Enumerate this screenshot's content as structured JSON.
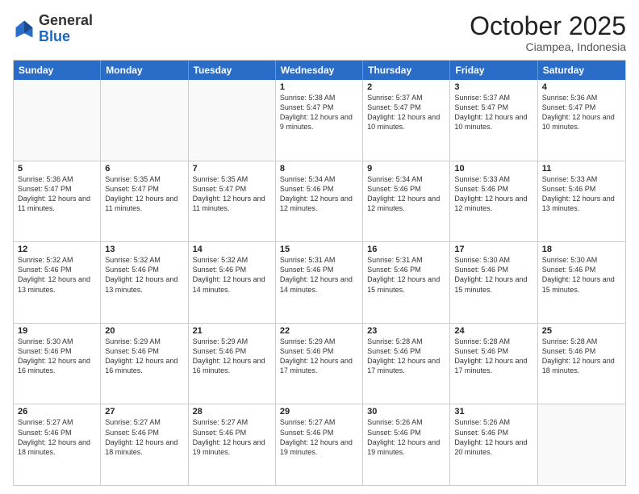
{
  "logo": {
    "general": "General",
    "blue": "Blue"
  },
  "title": "October 2025",
  "location": "Ciampea, Indonesia",
  "weekdays": [
    "Sunday",
    "Monday",
    "Tuesday",
    "Wednesday",
    "Thursday",
    "Friday",
    "Saturday"
  ],
  "rows": [
    [
      {
        "day": "",
        "empty": true
      },
      {
        "day": "",
        "empty": true
      },
      {
        "day": "",
        "empty": true
      },
      {
        "day": "1",
        "sunrise": "5:38 AM",
        "sunset": "5:47 PM",
        "daylight": "12 hours and 9 minutes."
      },
      {
        "day": "2",
        "sunrise": "5:37 AM",
        "sunset": "5:47 PM",
        "daylight": "12 hours and 10 minutes."
      },
      {
        "day": "3",
        "sunrise": "5:37 AM",
        "sunset": "5:47 PM",
        "daylight": "12 hours and 10 minutes."
      },
      {
        "day": "4",
        "sunrise": "5:36 AM",
        "sunset": "5:47 PM",
        "daylight": "12 hours and 10 minutes."
      }
    ],
    [
      {
        "day": "5",
        "sunrise": "5:36 AM",
        "sunset": "5:47 PM",
        "daylight": "12 hours and 11 minutes."
      },
      {
        "day": "6",
        "sunrise": "5:35 AM",
        "sunset": "5:47 PM",
        "daylight": "12 hours and 11 minutes."
      },
      {
        "day": "7",
        "sunrise": "5:35 AM",
        "sunset": "5:47 PM",
        "daylight": "12 hours and 11 minutes."
      },
      {
        "day": "8",
        "sunrise": "5:34 AM",
        "sunset": "5:46 PM",
        "daylight": "12 hours and 12 minutes."
      },
      {
        "day": "9",
        "sunrise": "5:34 AM",
        "sunset": "5:46 PM",
        "daylight": "12 hours and 12 minutes."
      },
      {
        "day": "10",
        "sunrise": "5:33 AM",
        "sunset": "5:46 PM",
        "daylight": "12 hours and 12 minutes."
      },
      {
        "day": "11",
        "sunrise": "5:33 AM",
        "sunset": "5:46 PM",
        "daylight": "12 hours and 13 minutes."
      }
    ],
    [
      {
        "day": "12",
        "sunrise": "5:32 AM",
        "sunset": "5:46 PM",
        "daylight": "12 hours and 13 minutes."
      },
      {
        "day": "13",
        "sunrise": "5:32 AM",
        "sunset": "5:46 PM",
        "daylight": "12 hours and 13 minutes."
      },
      {
        "day": "14",
        "sunrise": "5:32 AM",
        "sunset": "5:46 PM",
        "daylight": "12 hours and 14 minutes."
      },
      {
        "day": "15",
        "sunrise": "5:31 AM",
        "sunset": "5:46 PM",
        "daylight": "12 hours and 14 minutes."
      },
      {
        "day": "16",
        "sunrise": "5:31 AM",
        "sunset": "5:46 PM",
        "daylight": "12 hours and 15 minutes."
      },
      {
        "day": "17",
        "sunrise": "5:30 AM",
        "sunset": "5:46 PM",
        "daylight": "12 hours and 15 minutes."
      },
      {
        "day": "18",
        "sunrise": "5:30 AM",
        "sunset": "5:46 PM",
        "daylight": "12 hours and 15 minutes."
      }
    ],
    [
      {
        "day": "19",
        "sunrise": "5:30 AM",
        "sunset": "5:46 PM",
        "daylight": "12 hours and 16 minutes."
      },
      {
        "day": "20",
        "sunrise": "5:29 AM",
        "sunset": "5:46 PM",
        "daylight": "12 hours and 16 minutes."
      },
      {
        "day": "21",
        "sunrise": "5:29 AM",
        "sunset": "5:46 PM",
        "daylight": "12 hours and 16 minutes."
      },
      {
        "day": "22",
        "sunrise": "5:29 AM",
        "sunset": "5:46 PM",
        "daylight": "12 hours and 17 minutes."
      },
      {
        "day": "23",
        "sunrise": "5:28 AM",
        "sunset": "5:46 PM",
        "daylight": "12 hours and 17 minutes."
      },
      {
        "day": "24",
        "sunrise": "5:28 AM",
        "sunset": "5:46 PM",
        "daylight": "12 hours and 17 minutes."
      },
      {
        "day": "25",
        "sunrise": "5:28 AM",
        "sunset": "5:46 PM",
        "daylight": "12 hours and 18 minutes."
      }
    ],
    [
      {
        "day": "26",
        "sunrise": "5:27 AM",
        "sunset": "5:46 PM",
        "daylight": "12 hours and 18 minutes."
      },
      {
        "day": "27",
        "sunrise": "5:27 AM",
        "sunset": "5:46 PM",
        "daylight": "12 hours and 18 minutes."
      },
      {
        "day": "28",
        "sunrise": "5:27 AM",
        "sunset": "5:46 PM",
        "daylight": "12 hours and 19 minutes."
      },
      {
        "day": "29",
        "sunrise": "5:27 AM",
        "sunset": "5:46 PM",
        "daylight": "12 hours and 19 minutes."
      },
      {
        "day": "30",
        "sunrise": "5:26 AM",
        "sunset": "5:46 PM",
        "daylight": "12 hours and 19 minutes."
      },
      {
        "day": "31",
        "sunrise": "5:26 AM",
        "sunset": "5:46 PM",
        "daylight": "12 hours and 20 minutes."
      },
      {
        "day": "",
        "empty": true
      }
    ]
  ]
}
